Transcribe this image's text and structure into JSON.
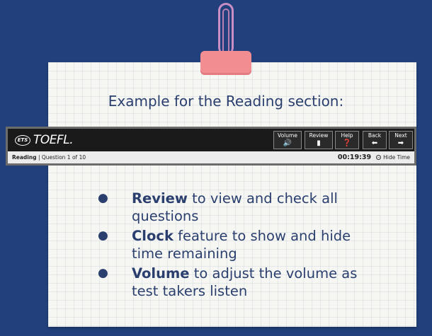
{
  "heading": "Example for the Reading section:",
  "toolbar": {
    "logo_ets": "ETS",
    "logo_toefl": "TOEFL",
    "logo_dot": ".",
    "buttons": [
      {
        "label": "Volume",
        "icon": "speaker-icon",
        "glyph": "🔊"
      },
      {
        "label": "Review",
        "icon": "bookmark-icon",
        "glyph": "▮"
      },
      {
        "label": "Help",
        "icon": "question-icon",
        "glyph": "❓"
      },
      {
        "label": "Back",
        "icon": "arrow-left-icon",
        "glyph": "⬅"
      },
      {
        "label": "Next",
        "icon": "arrow-right-icon",
        "glyph": "➡"
      }
    ],
    "status": {
      "section": "Reading",
      "separator": " | ",
      "question": "Question 1 of 10",
      "timer": "00:19:39",
      "hide_time": "Hide Time"
    }
  },
  "bullets": [
    {
      "bold": "Review",
      "rest": " to view and check all questions"
    },
    {
      "bold": "Clock",
      "rest": " feature to show and hide time remaining"
    },
    {
      "bold": "Volume",
      "rest": " to adjust the volume as test takers listen"
    }
  ],
  "bullet_glyph": "●",
  "colors": {
    "background": "#22407c",
    "card": "#f6f6f3",
    "text": "#2a3f6e",
    "clip": "#f28d92",
    "toolbar": "#1a1a1a"
  }
}
